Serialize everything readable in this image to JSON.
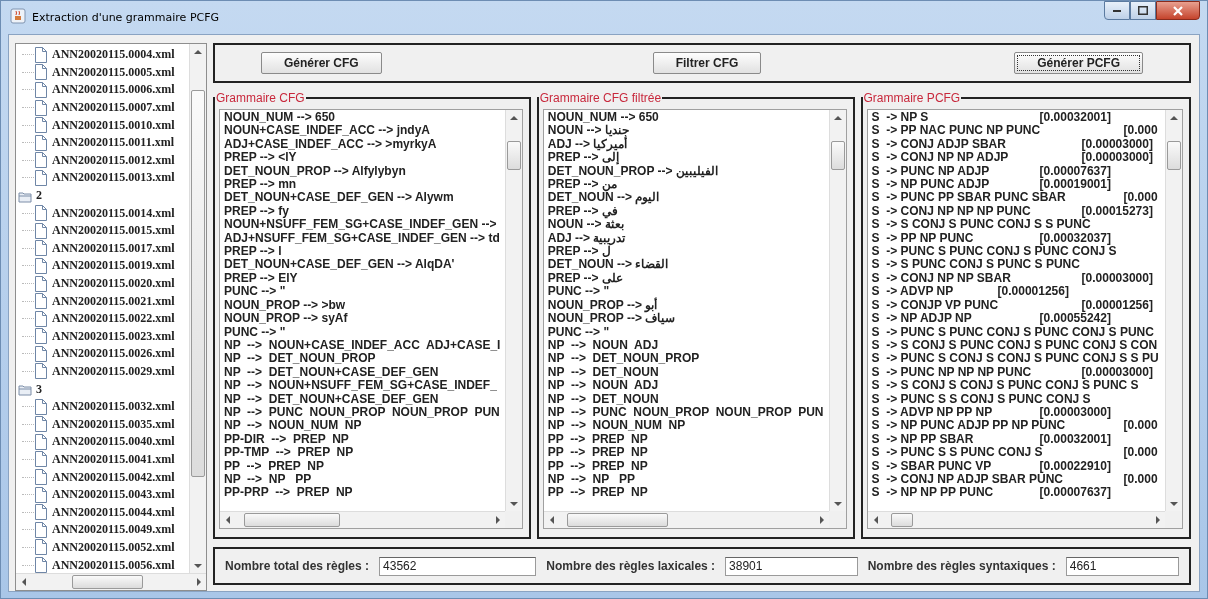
{
  "window": {
    "title": "Extraction d'une grammaire PCFG"
  },
  "tree": {
    "groups": [
      {
        "files": [
          "ANN20020115.0004.xml",
          "ANN20020115.0005.xml",
          "ANN20020115.0006.xml",
          "ANN20020115.0007.xml",
          "ANN20020115.0010.xml",
          "ANN20020115.0011.xml",
          "ANN20020115.0012.xml",
          "ANN20020115.0013.xml"
        ]
      },
      {
        "label": "2",
        "files": [
          "ANN20020115.0014.xml",
          "ANN20020115.0015.xml",
          "ANN20020115.0017.xml",
          "ANN20020115.0019.xml",
          "ANN20020115.0020.xml",
          "ANN20020115.0021.xml",
          "ANN20020115.0022.xml",
          "ANN20020115.0023.xml",
          "ANN20020115.0026.xml",
          "ANN20020115.0029.xml"
        ]
      },
      {
        "label": "3",
        "files": [
          "ANN20020115.0032.xml",
          "ANN20020115.0035.xml",
          "ANN20020115.0040.xml",
          "ANN20020115.0041.xml",
          "ANN20020115.0042.xml",
          "ANN20020115.0043.xml",
          "ANN20020115.0044.xml",
          "ANN20020115.0049.xml",
          "ANN20020115.0052.xml",
          "ANN20020115.0056.xml"
        ]
      }
    ]
  },
  "buttons": [
    {
      "label": "Générer CFG",
      "focused": false
    },
    {
      "label": "Filtrer CFG",
      "focused": false
    },
    {
      "label": "Générer PCFG",
      "focused": true
    }
  ],
  "panels": [
    {
      "title": "Grammaire CFG",
      "lines": [
        "NOUN_NUM --> 650",
        "NOUN+CASE_INDEF_ACC --> jndyA",
        "ADJ+CASE_INDEF_ACC --> >myrkyA",
        "PREP --> <lY",
        "DET_NOUN_PROP --> Alfylybyn",
        "PREP --> mn",
        "DET_NOUN+CASE_DEF_GEN --> Alywm",
        "PREP --> fy",
        "NOUN+NSUFF_FEM_SG+CASE_INDEF_GEN -->",
        "ADJ+NSUFF_FEM_SG+CASE_INDEF_GEN --> td",
        "PREP --> l",
        "DET_NOUN+CASE_DEF_GEN --> AlqDA'",
        "PREP --> ElY",
        "PUNC --> \"",
        "NOUN_PROP --> >bw",
        "NOUN_PROP --> syAf",
        "PUNC --> \"",
        "NP  -->  NOUN+CASE_INDEF_ACC  ADJ+CASE_I",
        "NP  -->  DET_NOUN_PROP",
        "NP  -->  DET_NOUN+CASE_DEF_GEN",
        "NP  -->  NOUN+NSUFF_FEM_SG+CASE_INDEF_",
        "NP  -->  DET_NOUN+CASE_DEF_GEN",
        "NP  -->  PUNC  NOUN_PROP  NOUN_PROP  PUN",
        "NP  -->  NOUN_NUM  NP",
        "PP-DIR  -->  PREP  NP",
        "PP-TMP  -->  PREP  NP",
        "PP  -->  PREP  NP",
        "NP  -->  NP   PP",
        "PP-PRP  -->  PREP  NP"
      ]
    },
    {
      "title": "Grammaire CFG filtrée",
      "lines": [
        "NOUN_NUM --> 650",
        "NOUN --> جنديا",
        "ADJ --> أميركيا",
        "PREP --> إلى",
        "DET_NOUN_PROP --> الفيليبين",
        "PREP --> من",
        "DET_NOUN --> اليوم",
        "PREP --> في",
        "NOUN --> بعثة",
        "ADJ --> تدريبية",
        "PREP --> ل",
        "DET_NOUN --> القضاء",
        "PREP --> على",
        "PUNC --> \"",
        "NOUN_PROP --> أبو",
        "NOUN_PROP --> سياف",
        "PUNC --> \"",
        "NP  -->  NOUN  ADJ",
        "NP  -->  DET_NOUN_PROP",
        "NP  -->  DET_NOUN",
        "NP  -->  NOUN  ADJ",
        "NP  -->  DET_NOUN",
        "NP  -->  PUNC  NOUN_PROP  NOUN_PROP  PUN",
        "NP  -->  NOUN_NUM  NP",
        "PP  -->  PREP  NP",
        "PP  -->  PREP  NP",
        "PP  -->  PREP  NP",
        "NP  -->  NP   PP",
        "PP  -->  PREP  NP"
      ]
    },
    {
      "title": "Grammaire PCFG",
      "lines": [
        "S  -> NP S\t\t\t[0.00032001]",
        "S  -> PP NAC PUNC NP PUNC\t\t[0.000",
        "S  -> CONJ ADJP SBAR\t\t[0.00003000]",
        "S  -> CONJ NP NP ADJP\t\t[0.00003000]",
        "S  -> PUNC NP ADJP\t\t[0.00007637]",
        "S  -> NP PUNC ADJP\t\t[0.00019001]",
        "S  -> PUNC PP SBAR PUNC SBAR\t\t[0.000",
        "S  -> CONJ NP NP NP PUNC\t\t[0.00015273]",
        "S  -> S CONJ S PUNC CONJ S S PUNC",
        "S  -> PP NP PUNC\t\t[0.00032037]",
        "S  -> PUNC S PUNC CONJ S PUNC CONJ S",
        "S  -> S PUNC CONJ S PUNC S PUNC",
        "S  -> CONJ NP NP SBAR\t\t[0.00003000]",
        "S  -> ADVP NP\t\t[0.00001256]",
        "S  -> CONJP VP PUNC\t\t[0.00001256]",
        "S  -> NP ADJP NP\t\t[0.00055242]",
        "S  -> PUNC S PUNC CONJ S PUNC CONJ S PUNC",
        "S  -> S CONJ S PUNC CONJ S PUNC CONJ S CON",
        "S  -> PUNC S CONJ S CONJ S PUNC CONJ S S PU",
        "S  -> PUNC NP NP NP PUNC\t\t[0.00003000]",
        "S  -> S CONJ S CONJ S PUNC CONJ S PUNC S",
        "S  -> PUNC S S CONJ S PUNC CONJ S",
        "S  -> ADVP NP PP NP\t\t[0.00003000]",
        "S  -> NP PUNC ADJP PP NP PUNC\t\t[0.000",
        "S  -> NP PP SBAR\t\t[0.00032001]",
        "S  -> PUNC S S PUNC CONJ S\t\t[0.000",
        "S  -> SBAR PUNC VP\t\t[0.00022910]",
        "S  -> CONJ NP ADJP SBAR PUNC\t\t[0.000",
        "S  -> NP NP PP PUNC\t\t[0.00007637]"
      ]
    }
  ],
  "counts": [
    {
      "label": "Nombre total des règles :",
      "value": "43562"
    },
    {
      "label": "Nombre des règles laxicales :",
      "value": "38901"
    },
    {
      "label": "Nombre des règles syntaxiques :",
      "value": "4661"
    }
  ]
}
